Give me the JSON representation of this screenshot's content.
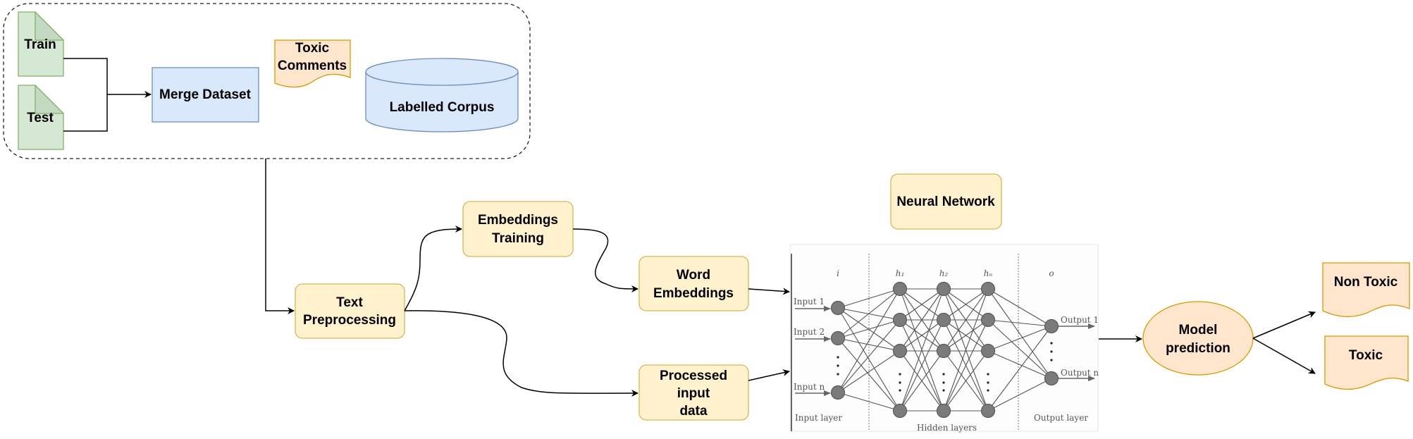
{
  "colors": {
    "green_fill": "#d5e8d4",
    "green_stroke": "#82b366",
    "green_fold": "#c4d9c2",
    "blue_fill": "#dae8fc",
    "blue_stroke": "#6c8ebf",
    "yellow_fill": "#fff2cc",
    "yellow_stroke": "#d6b656",
    "orange_fill": "#ffe6cc",
    "orange_stroke": "#d79b00",
    "nn_node": "#7b7b7b",
    "nn_edge": "#555555"
  },
  "data_group": {
    "train_label": "Train",
    "test_label": "Test",
    "merge_label": "Merge Dataset",
    "toxic_comments_label": [
      "Toxic",
      "Comments"
    ],
    "corpus_label": "Labelled Corpus"
  },
  "pipeline": {
    "text_preprocessing": [
      "Text",
      "Preprocessing"
    ],
    "embeddings_training": [
      "Embeddings",
      "Training"
    ],
    "word_embeddings": [
      "Word",
      "Embeddings"
    ],
    "processed_input": [
      "Processed",
      "input",
      "data"
    ],
    "neural_network_label": "Neural Network",
    "model_prediction": [
      "Model",
      "prediction"
    ],
    "output_non_toxic": "Non Toxic",
    "output_toxic": "Toxic"
  },
  "neural_net_figure": {
    "layer_symbols": {
      "input": "i",
      "h1": "h₁",
      "h2": "h₂",
      "hn": "hₙ",
      "output": "o"
    },
    "inputs": [
      "Input 1",
      "Input 2",
      "Input n"
    ],
    "outputs": [
      "Output 1",
      "Output n"
    ],
    "layer_captions": {
      "input": "Input layer",
      "hidden": "Hidden layers",
      "output": "Output layer"
    },
    "hidden_layers": 3,
    "hidden_nodes_shown": 4,
    "input_nodes_shown": 3,
    "output_nodes_shown": 2
  }
}
